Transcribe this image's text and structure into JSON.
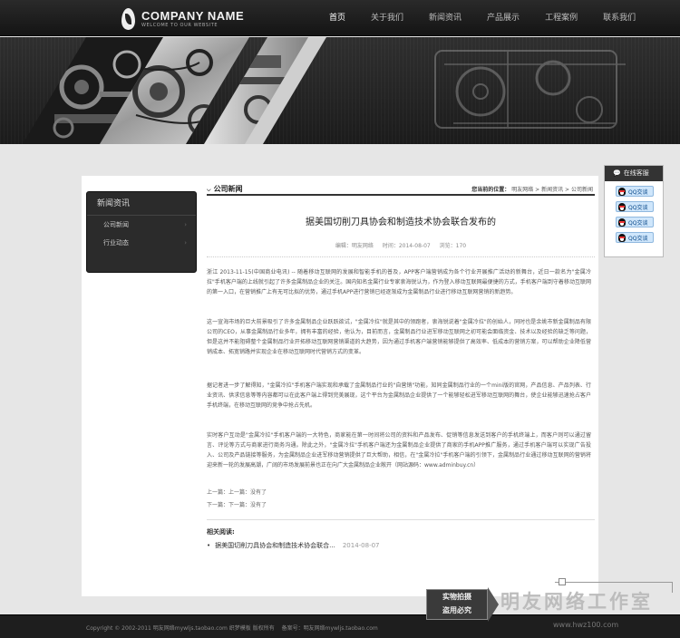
{
  "header": {
    "company_name": "COMPANY NAME",
    "slogan": "WELCOME TO OUR WEBSITE",
    "nav": [
      {
        "label": "首页",
        "active": true
      },
      {
        "label": "关于我们",
        "active": false
      },
      {
        "label": "新闻资讯",
        "active": false
      },
      {
        "label": "产品展示",
        "active": false
      },
      {
        "label": "工程案例",
        "active": false
      },
      {
        "label": "联系我们",
        "active": false
      }
    ]
  },
  "sidebar": {
    "title": "新闻资讯",
    "items": [
      {
        "label": "公司新闻",
        "chev": "›"
      },
      {
        "label": "行业动态",
        "chev": "›"
      }
    ]
  },
  "content": {
    "section_title": "公司新闻",
    "breadcrumb": {
      "label": "您当前的位置：",
      "items": [
        "明友网络",
        "新闻资讯",
        "公司新闻"
      ],
      "sep": " > "
    },
    "article": {
      "title": "据美国切削刀具协会和制造技术协会联合发布的",
      "meta": {
        "editor": "编辑：明友网络",
        "time": "时间：2014-08-07",
        "views": "浏览：170"
      },
      "paragraphs": [
        "浙江 2013-11-15(中国商业电讯) -- 随着移动互联网的发展和智能手机的普及，APP客户端营销成为各个行业开展推广活动的新舞台，近日一款名为\"金属冷拉\"手机客户端的上线就引起了许多金属制品企业的关注。国内知名金属行业专家衷海锐认为，作为登入移动互联网最便捷的方式，手机客户端到守着移动互联网的第一入口，在营销推广上有无可比拟的优势，通过手机APP进行营销已经逐渐成为金属制品行业进行移动互联网营销的新趋势。",
        "这一宣海市场的巨大前景吸引了许多金属制品企业跃跃欲试，\"金属冷拉\"就是其中的领跑者，衷海锐说着\"金属冷拉\"的创始人，同时也是余姚市新金属制品有限公司的CEO，从事金属制品行业多年，拥有丰富的经验，他认为，目前而言，金属制品行业进军移动互联网之初可能会面临资金、技术以及经验的缺乏等问题，但是这并不能阻碍整个金属制品行业开拓移动互联网营销渠道的大趋势，因为通过手机客户端营销能够提供了高效率、低成本的营销方案，可以帮助企业降低营销成本、拓宽销路并实现企业在移动互联网时代营销方式的变革。",
        "据记者进一步了解得知，\"金属冷拉\"手机客户端实现和承载了金属制品行业的\"自营销\"功能，知同金属制品行业的一个mini版的官网，产品信息、产品列表、行业资讯、供求信息等等内容都可以在此客户端上得到完美展现，这个平台为金属制品企业提供了一个能够轻松进军移动互联网的舞台，使企业能够迅速抢占客户手机终端，在移动互联网的竞争中抢占先机。",
        "实时客户互动是\"金属冷拉\"手机客户端的一大特色，商家能在第一时间将公司的资料和产品发布、促销等信息发送到客户的手机终端上，而客户则可以通过留言、评论等方式与商家进行商务沟通。除此之外，\"金属冷拉\"手机客户端还为金属制品企业提供了商家的手机APP推广服务，通过手机客户端可以实现广告投入、公司及产品链接等服务，为金属制品企业进军移动营销提供了巨大帮助，相信，在\"金属冷拉\"手机客户端的引领下，金属制品行业通过移动互联网的营销将迎来新一轮的发展高潮，广阔的市场发展前景也正在向广大金属制品企业敞开（网站源码：www.adminbuy.cn）"
      ],
      "prev": "上一篇：上一篇：没有了",
      "next": "下一篇：下一篇：没有了"
    },
    "related": {
      "title": "相关阅读:",
      "items": [
        {
          "bullet": "•",
          "title": "据美国切削刀具协会和制造技术协会联合...",
          "date": "2014-08-07"
        }
      ]
    }
  },
  "service": {
    "title": "在线客服",
    "qq_buttons": [
      "QQ交谈",
      "QQ交谈",
      "QQ交谈",
      "QQ交谈"
    ]
  },
  "footer": {
    "copyright": "Copyright © 2002-2011 明友网络mywljs.taobao.com 织梦模板 版权所有",
    "icp": "备案号：明友网络mywljs.taobao.com"
  },
  "watermark": {
    "box_line1": "实物拍摄",
    "box_line2": "盗用必究",
    "name": "明友网络工作室",
    "url": "www.hwz100.com"
  },
  "colors": {
    "header_bg": "#1e1e1e",
    "panel_bg": "#ffffff",
    "page_bg": "#e6e6e6",
    "qq_button": "#cfe6fb"
  }
}
